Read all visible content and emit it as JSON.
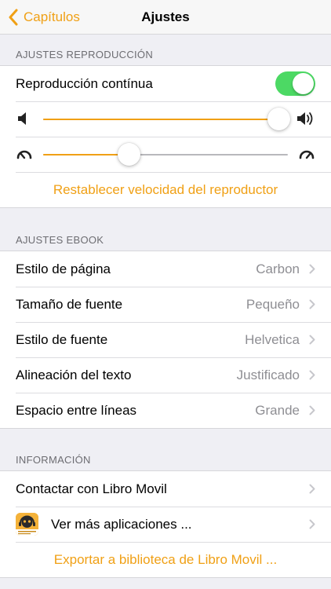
{
  "nav": {
    "back_label": "Capítulos",
    "title": "Ajustes"
  },
  "playback": {
    "header": "AJUSTES REPRODUCCIÓN",
    "continuous_label": "Reproducción contínua",
    "continuous_on": true,
    "volume_level": 0.96,
    "speed_level": 0.35,
    "reset_label": "Restablecer velocidad del reproductor"
  },
  "ebook": {
    "header": "AJUSTES EBOOK",
    "items": [
      {
        "label": "Estilo de página",
        "value": "Carbon"
      },
      {
        "label": "Tamaño de fuente",
        "value": "Pequeño"
      },
      {
        "label": "Estilo de fuente",
        "value": "Helvetica"
      },
      {
        "label": "Alineación del texto",
        "value": "Justificado"
      },
      {
        "label": "Espacio entre líneas",
        "value": "Grande"
      }
    ]
  },
  "info": {
    "header": "INFORMACIÓN",
    "contact_label": "Contactar con Libro Movil",
    "more_apps_label": "Ver más aplicaciones ...",
    "export_label": "Exportar a biblioteca de Libro Movil ..."
  },
  "colors": {
    "accent": "#f0a015",
    "toggle_on": "#4cd964",
    "secondary_text": "#8e8e93"
  }
}
